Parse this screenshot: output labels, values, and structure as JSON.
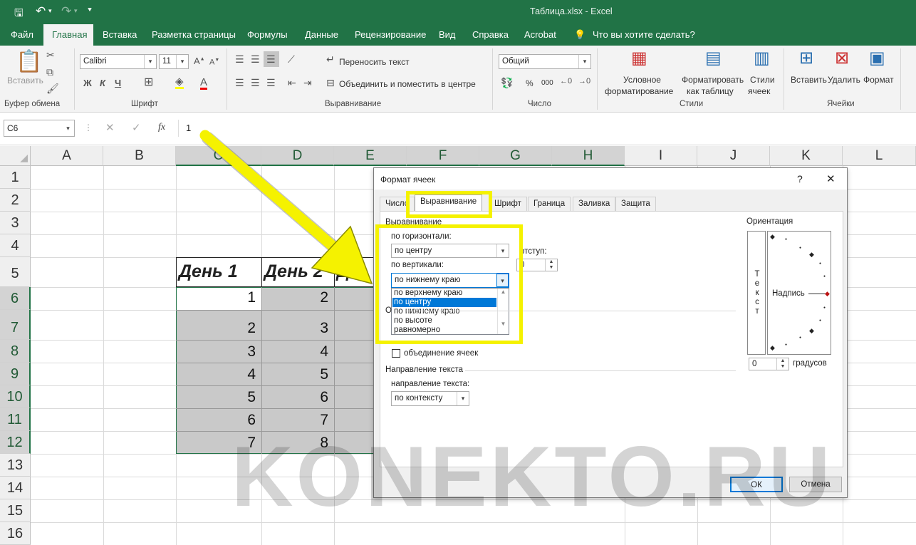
{
  "window": {
    "title": "Таблица.xlsx  -  Excel"
  },
  "qat": {
    "save_icon": "save-icon",
    "undo_icon": "undo-icon",
    "redo_icon": "redo-icon"
  },
  "ribbon_tabs": [
    "Файл",
    "Главная",
    "Вставка",
    "Разметка страницы",
    "Формулы",
    "Данные",
    "Рецензирование",
    "Вид",
    "Справка",
    "Acrobat",
    "Что вы хотите сделать?"
  ],
  "ribbon": {
    "clipboard": {
      "paste": "Вставить",
      "group": "Буфер обмена"
    },
    "font": {
      "name": "Calibri",
      "size": "11",
      "bold": "Ж",
      "italic": "К",
      "underline": "Ч",
      "group": "Шрифт"
    },
    "alignment": {
      "wrap": "Переносить текст",
      "merge": "Объединить и поместить в центре",
      "group": "Выравнивание"
    },
    "number": {
      "format": "Общий",
      "percent": "%",
      "thousands": "000",
      "group": "Число"
    },
    "styles": {
      "cond": "Условное",
      "cond2": "форматирование",
      "table": "Форматировать",
      "table2": "как таблицу",
      "cell": "Стили",
      "cell2": "ячеек",
      "group": "Стили"
    },
    "cells": {
      "insert": "Вставить",
      "delete": "Удалить",
      "format": "Формат",
      "group": "Ячейки"
    }
  },
  "formula_bar": {
    "name_box": "C6",
    "fx": "fx",
    "value": "1"
  },
  "columns": [
    "A",
    "B",
    "C",
    "D",
    "E",
    "F",
    "G",
    "H",
    "I",
    "J",
    "K",
    "L"
  ],
  "rows": [
    "1",
    "2",
    "3",
    "4",
    "5",
    "6",
    "7",
    "8",
    "9",
    "10",
    "11",
    "12",
    "13",
    "14",
    "15",
    "16"
  ],
  "sheet": {
    "headers": [
      "День 1",
      "День 2",
      "Де"
    ],
    "col_c": [
      "1",
      "2",
      "3",
      "4",
      "5",
      "6",
      "7"
    ],
    "col_d": [
      "2",
      "3",
      "4",
      "5",
      "6",
      "7",
      "8"
    ]
  },
  "dialog": {
    "title": "Формат ячеек",
    "help": "?",
    "close": "✕",
    "tabs": [
      "Число",
      "Выравнивание",
      "Шрифт",
      "Граница",
      "Заливка",
      "Защита"
    ],
    "section_alignment": "Выравнивание",
    "horizontal_label": "по горизонтали:",
    "horizontal_value": "по центру",
    "indent_label": "отступ:",
    "indent_value": "0",
    "vertical_label": "по вертикали:",
    "vertical_value": "по нижнему краю",
    "vertical_options": [
      "по верхнему краю",
      "по центру",
      "по нижнему краю",
      "по высоте",
      "равномерно"
    ],
    "vertical_selected_index": 1,
    "section_display": "О",
    "merge_label": "объединение ячеек",
    "section_direction": "Направление текста",
    "direction_label": "направление текста:",
    "direction_value": "по контексту",
    "orientation_label": "Ориентация",
    "orientation_vertical_text": "Т е к с т",
    "orientation_caption": "Надпись",
    "degrees_value": "0",
    "degrees_label": "градусов",
    "ok": "ОК",
    "cancel": "Отмена"
  },
  "watermark": "KONEKTO.RU",
  "colors": {
    "excel_green": "#217346",
    "highlight": "#f5f200",
    "selection": "#c9c9c9",
    "list_select": "#0078d7"
  }
}
